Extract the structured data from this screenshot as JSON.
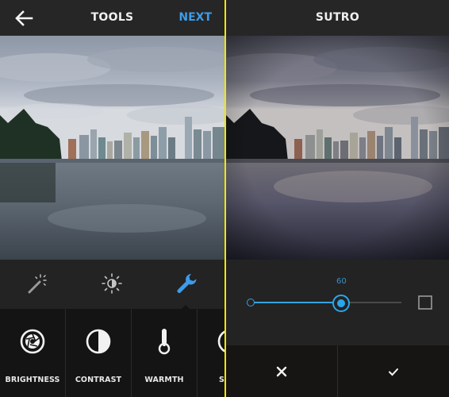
{
  "left_screen": {
    "header": {
      "title": "TOOLS",
      "back_icon": "arrow-left-icon",
      "next_label": "NEXT"
    },
    "photo": {
      "description": "Vancouver skyline across harbour water, overcast sky, original"
    },
    "tool_tabs": [
      {
        "name": "lux",
        "icon": "magic-wand-icon",
        "active": false
      },
      {
        "name": "filters",
        "icon": "brightness-contrast-sun-icon",
        "active": false
      },
      {
        "name": "tools",
        "icon": "wrench-icon",
        "active": true
      }
    ],
    "tools": [
      {
        "label": "BRIGHTNESS",
        "icon": "aperture-icon"
      },
      {
        "label": "CONTRAST",
        "icon": "half-circle-icon"
      },
      {
        "label": "WARMTH",
        "icon": "thermometer-icon"
      },
      {
        "label": "SATU",
        "icon": "saturation-icon"
      }
    ]
  },
  "right_screen": {
    "header": {
      "title": "SUTRO"
    },
    "photo": {
      "description": "Same Vancouver skyline with Sutro filter applied (darker, purple tint, vignette)"
    },
    "slider": {
      "value_label": "60",
      "value": 60,
      "min": 0,
      "max": 100
    },
    "border_toggle_icon": "frame-square-icon",
    "actions": {
      "cancel_icon": "close-icon",
      "confirm_icon": "checkmark-icon"
    }
  },
  "colors": {
    "accent_blue": "#3d9be9",
    "divider_yellow": "#f2e600",
    "topbar": "#262626",
    "panel": "#232323",
    "toolbar_dark": "#151414"
  }
}
